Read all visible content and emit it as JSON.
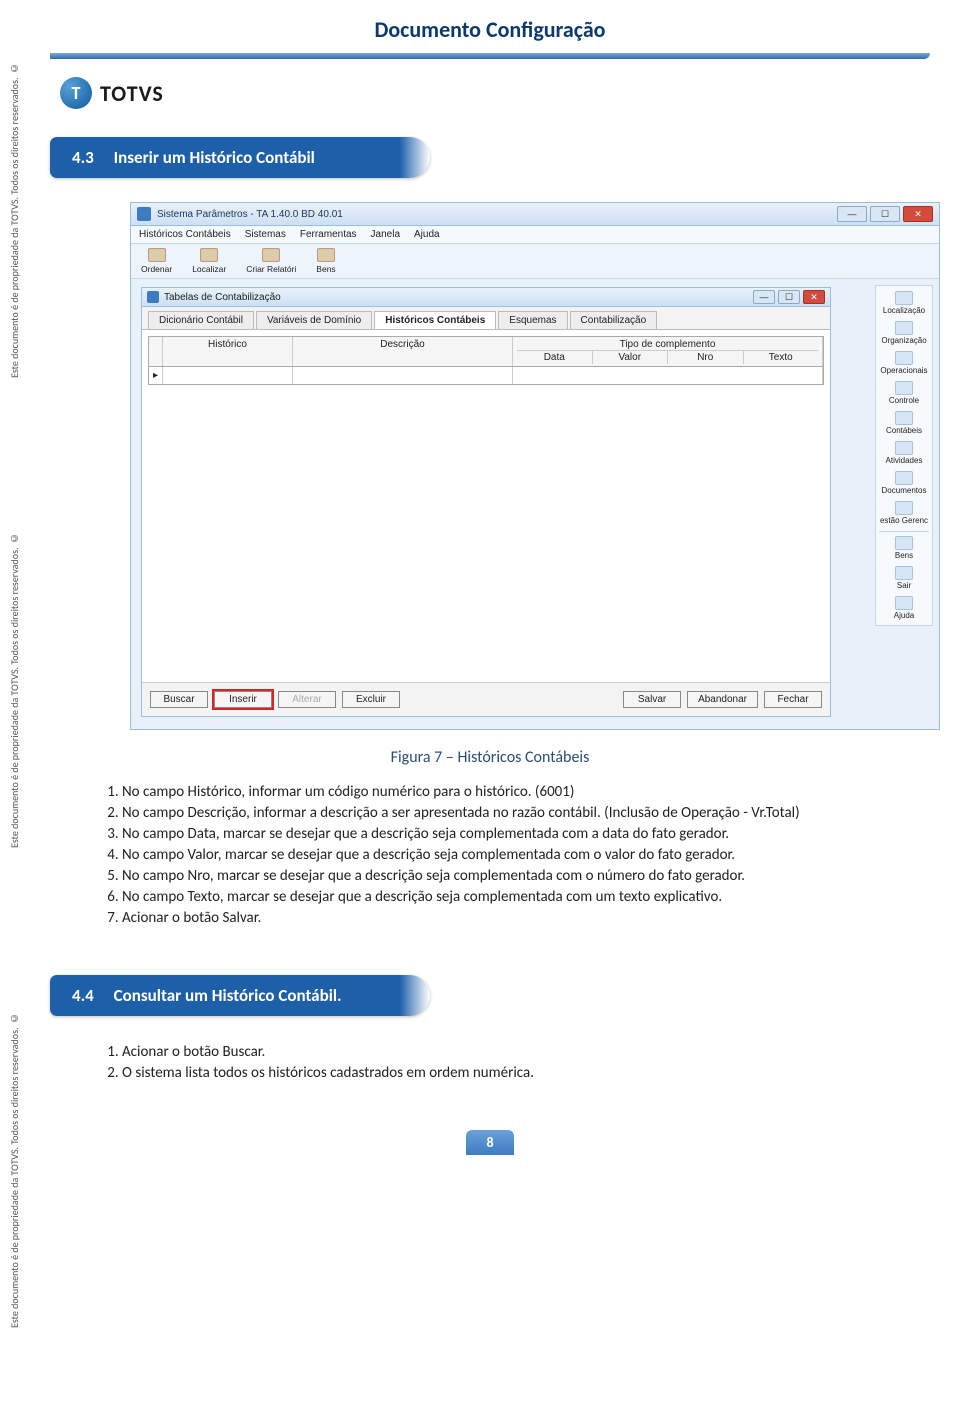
{
  "vertical_note": "Este documento é de propriedade da TOTVS. Todos os direitos reservados. ©",
  "doc_title": "Documento Configuração",
  "brand": {
    "letter": "T",
    "name": "TOTVS"
  },
  "section1": {
    "number": "4.3",
    "title": "Inserir um Histórico Contábil"
  },
  "screenshot": {
    "window_title": "Sistema Parâmetros - TA 1.40.0 BD 40.01",
    "menu": [
      "Históricos Contábeis",
      "Sistemas",
      "Ferramentas",
      "Janela",
      "Ajuda"
    ],
    "toolbar": [
      "Ordenar",
      "Localizar",
      "Criar Relatóri",
      "Bens"
    ],
    "inner_title": "Tabelas de Contabilização",
    "tabs": [
      "Dicionário Contábil",
      "Variáveis de Domínio",
      "Históricos Contábeis",
      "Esquemas",
      "Contabilização"
    ],
    "active_tab": 2,
    "grid_headers": {
      "hist": "Histórico",
      "desc": "Descrição",
      "tipo": "Tipo de complemento",
      "sub": [
        "Data",
        "Valor",
        "Nro",
        "Texto"
      ]
    },
    "buttons": [
      "Buscar",
      "Inserir",
      "Alterar",
      "Excluir",
      "Salvar",
      "Abandonar",
      "Fechar"
    ],
    "highlighted_button": 1,
    "disabled_button": 2,
    "side_items": [
      "Localização",
      "Organização",
      "Operacionais",
      "Controle",
      "Contábeis",
      "Atividades",
      "Documentos",
      "estão Gerenc",
      "Bens",
      "Sair",
      "Ajuda"
    ]
  },
  "caption": "Figura 7 – Históricos Contábeis",
  "instructions": [
    "No campo Histórico, informar um código numérico para o histórico. (6001)",
    "No campo Descrição, informar a descrição a ser apresentada no razão contábil. (Inclusão de Operação - Vr.Total)",
    "No campo Data, marcar se desejar que a descrição seja complementada com a data do fato gerador.",
    "No campo Valor, marcar se desejar que a descrição seja complementada com o valor do fato gerador.",
    "No campo Nro, marcar se desejar que a descrição seja complementada com o número do fato gerador.",
    "No campo Texto, marcar se desejar que a descrição seja complementada com um texto explicativo.",
    "Acionar o botão Salvar."
  ],
  "section2": {
    "number": "4.4",
    "title": "Consultar um Histórico Contábil."
  },
  "instructions2": [
    "Acionar o botão Buscar.",
    "O sistema lista todos os históricos cadastrados em ordem numérica."
  ],
  "page_number": "8"
}
